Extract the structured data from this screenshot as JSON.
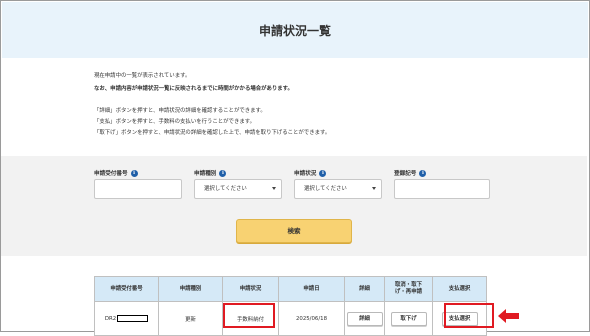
{
  "page_title": "申請状況一覧",
  "description": {
    "line1": "現在申請中の一覧が表示されています。",
    "line2": "なお、申請内容が申請状況一覧に反映されるまでに時間がかかる場合があります。",
    "line3": "「詳細」ボタンを押すと、申請状況の詳細を確認することができます。",
    "line4": "「支払」ボタンを押すと、手数料の支払いを行うことができます。",
    "line5": "「取下げ」ボタンを押すと、申請状況の詳細を確認した上で、申請を取り下げることができます。"
  },
  "search_form": {
    "receipt_number_label": "申請受付番号",
    "type_label": "申請種別",
    "type_value": "選択してください",
    "status_label": "申請状況",
    "status_value": "選択してください",
    "registration_label": "登録記号",
    "info_glyph": "i",
    "search_button": "検索"
  },
  "table": {
    "headers": {
      "receipt_number": "申請受付番号",
      "type": "申請種別",
      "status": "申請状況",
      "date": "申請日",
      "detail": "詳細",
      "cancel_line1": "取消・取下",
      "cancel_line2": "げ・再申請",
      "payment": "支払選択"
    },
    "rows": [
      {
        "receipt_number_prefix": "DR2",
        "type": "更新",
        "status": "手数料納付",
        "date": "2025/06/18",
        "detail_button": "詳細",
        "cancel_button": "取下げ",
        "payment_button": "支払選択"
      }
    ]
  },
  "colors": {
    "header_bg": "#e8f3fb",
    "search_bg": "#f2f2f2",
    "search_button": "#f8d272",
    "table_header_bg": "#d5e9f7",
    "highlight": "#e01a22",
    "info_icon": "#1f5fa8"
  }
}
